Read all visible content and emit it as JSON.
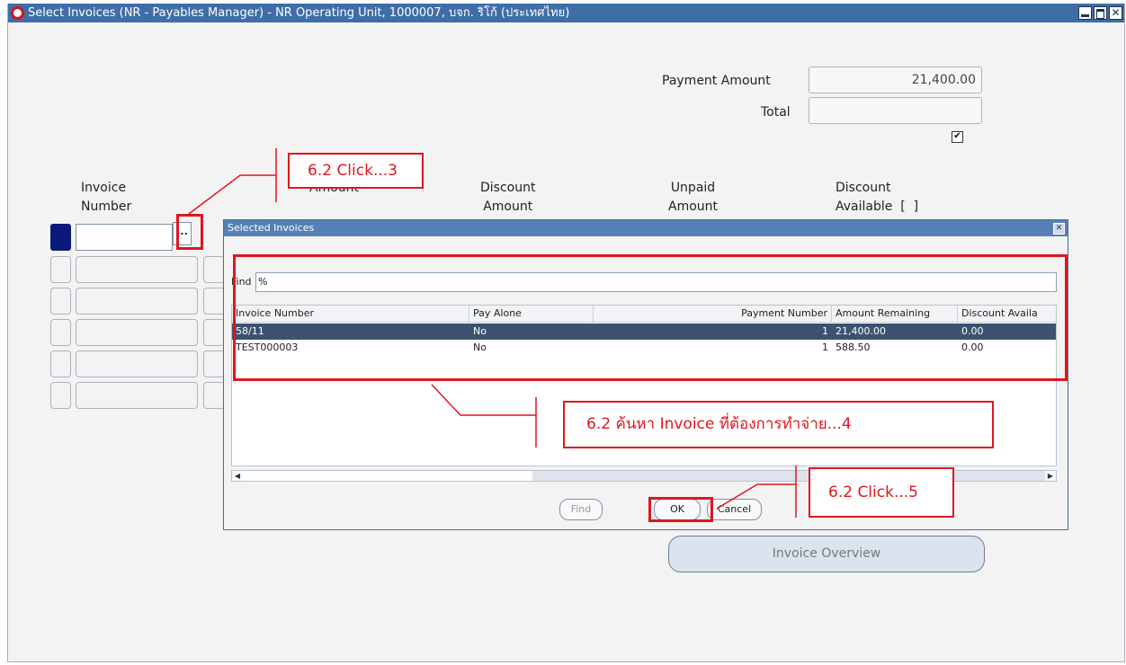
{
  "window": {
    "title": "Select Invoices (NR - Payables Manager) - NR Operating Unit, 1000007, บจก. ริโก้ (ประเทศไทย)",
    "controls": [
      "minimize-icon",
      "maximize-icon",
      "close-icon"
    ]
  },
  "summary": {
    "payment_amount_label": "Payment Amount",
    "payment_amount_value": "21,400.00",
    "total_label": "Total",
    "total_value": "",
    "checkbox_checked": true
  },
  "grid": {
    "headers": [
      {
        "line1": "Invoice",
        "line2": "Number"
      },
      {
        "line1": "",
        "line2": "Amount"
      },
      {
        "line1": "Discount",
        "line2": "Amount"
      },
      {
        "line1": "Unpaid",
        "line2": "Amount"
      },
      {
        "line1": "Discount",
        "line2": "Available  [  ]"
      }
    ],
    "ellipsis_label": "..."
  },
  "dialog": {
    "title": "Selected Invoices",
    "find_label": "Find",
    "find_value": "%",
    "columns": [
      "Invoice Number",
      "Pay Alone",
      "Payment Number",
      "Amount Remaining",
      "Discount Availa"
    ],
    "rows": [
      {
        "invoice_number": "58/11",
        "pay_alone": "No",
        "payment_number": "1",
        "amount_remaining": "21,400.00",
        "discount_available": "0.00"
      },
      {
        "invoice_number": "TEST000003",
        "pay_alone": "No",
        "payment_number": "1",
        "amount_remaining": "588.50",
        "discount_available": "0.00"
      }
    ],
    "find_button": "Find",
    "ok_button": "OK",
    "cancel_button": "Cancel"
  },
  "invoice_overview_button": "Invoice Overview",
  "callouts": {
    "click3": "6.2 Click...3",
    "search4": "6.2 ค้นหา Invoice ที่ต้องการทำจ่าย...4",
    "click5": "6.2 Click...5"
  },
  "colors": {
    "titlebar": "#3f6da8",
    "selected_row": "#3d5270",
    "annotation_red": "#e0161f"
  }
}
